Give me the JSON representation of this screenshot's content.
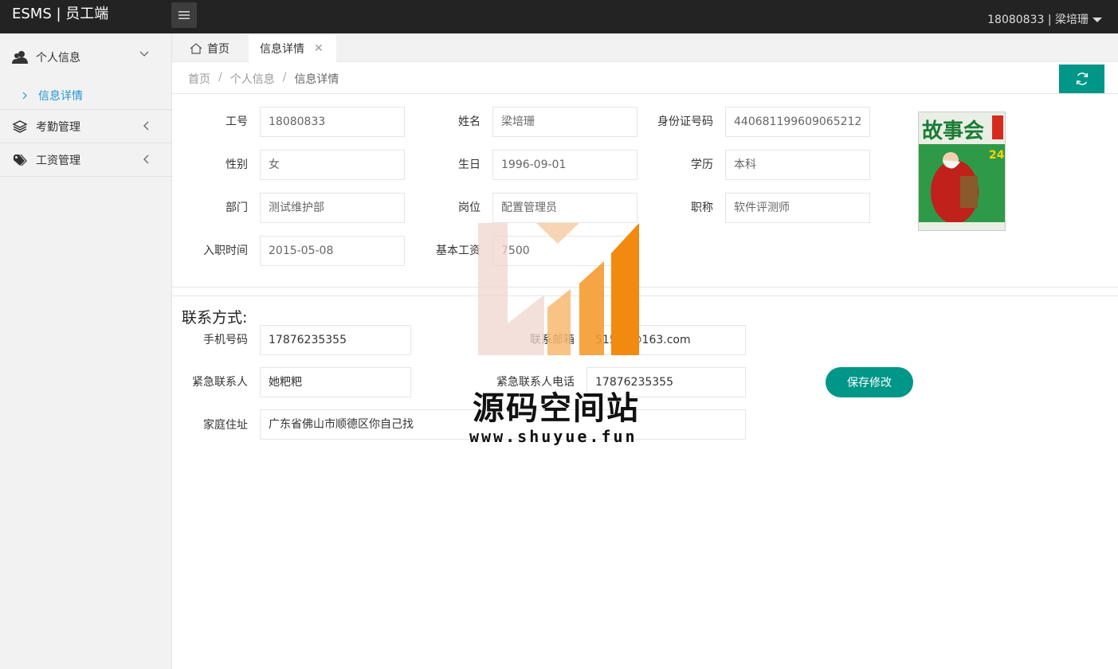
{
  "app": {
    "title": "ESMS | 员工端",
    "user": "18080833 | 梁培珊"
  },
  "sidebar": {
    "items": [
      {
        "label": "个人信息",
        "icon": "users-icon",
        "expanded": true,
        "children": [
          {
            "label": "信息详情"
          }
        ]
      },
      {
        "label": "考勤管理",
        "icon": "layers-icon"
      },
      {
        "label": "工资管理",
        "icon": "tag-icon"
      }
    ]
  },
  "tabs": [
    {
      "label": "首页",
      "icon": "home-icon"
    },
    {
      "label": "信息详情",
      "active": true
    }
  ],
  "breadcrumb": [
    "首页",
    "个人信息",
    "信息详情"
  ],
  "basic_info": {
    "emp_no": {
      "label": "工号",
      "value": "18080833"
    },
    "name": {
      "label": "姓名",
      "value": "梁培珊"
    },
    "id_card": {
      "label": "身份证号码",
      "value": "440681199609065212"
    },
    "gender": {
      "label": "性别",
      "value": "女"
    },
    "birthday": {
      "label": "生日",
      "value": "1996-09-01"
    },
    "education": {
      "label": "学历",
      "value": "本科"
    },
    "department": {
      "label": "部门",
      "value": "测试维护部"
    },
    "position": {
      "label": "岗位",
      "value": "配置管理员"
    },
    "title": {
      "label": "职称",
      "value": "软件评测师"
    },
    "hire_date": {
      "label": "入职时间",
      "value": "2015-05-08"
    },
    "base_salary": {
      "label": "基本工资",
      "value": "7500"
    }
  },
  "contact": {
    "section_title": "联系方式:",
    "phone": {
      "label": "手机号码",
      "value": "17876235355"
    },
    "email": {
      "label": "联系邮箱",
      "value": "51599@163.com"
    },
    "emergency_contact": {
      "label": "紧急联系人",
      "value": "她粑粑"
    },
    "emergency_phone": {
      "label": "紧急联系人电话",
      "value": "17876235355"
    },
    "address": {
      "label": "家庭住址",
      "value": "广东省佛山市顺德区你自己找"
    },
    "save_label": "保存修改"
  },
  "photo": {
    "masthead": "故事会",
    "issue": "24"
  },
  "watermark": {
    "text": "源码空间站",
    "url": "www.shuyue.fun"
  },
  "colors": {
    "accent": "#009688",
    "topbar": "#232323",
    "link": "#2196d3"
  }
}
